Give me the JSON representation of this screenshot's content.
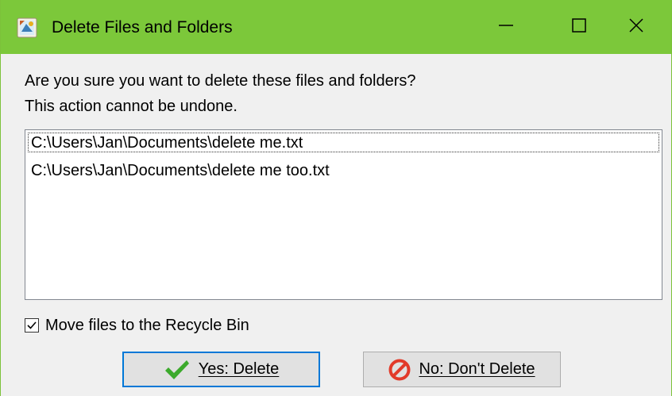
{
  "window": {
    "title": "Delete Files and Folders",
    "controls": {
      "minimize": "minimize-icon",
      "maximize": "maximize-icon",
      "close": "close-icon"
    },
    "titlebar_color": "#7cc83a"
  },
  "dialog": {
    "message_line1": "Are you sure you want to delete these files and folders?",
    "message_line2": "This action cannot be undone.",
    "files": [
      "C:\\Users\\Jan\\Documents\\delete me.txt",
      "C:\\Users\\Jan\\Documents\\delete me too.txt"
    ],
    "recycle_checkbox": {
      "label": "Move files to the Recycle Bin",
      "checked": true
    }
  },
  "buttons": {
    "yes_label": "Yes: Delete",
    "no_label": "No: Don't Delete",
    "yes_icon": "checkmark-icon",
    "no_icon": "prohibited-icon",
    "accent_color": "#0078d7"
  }
}
